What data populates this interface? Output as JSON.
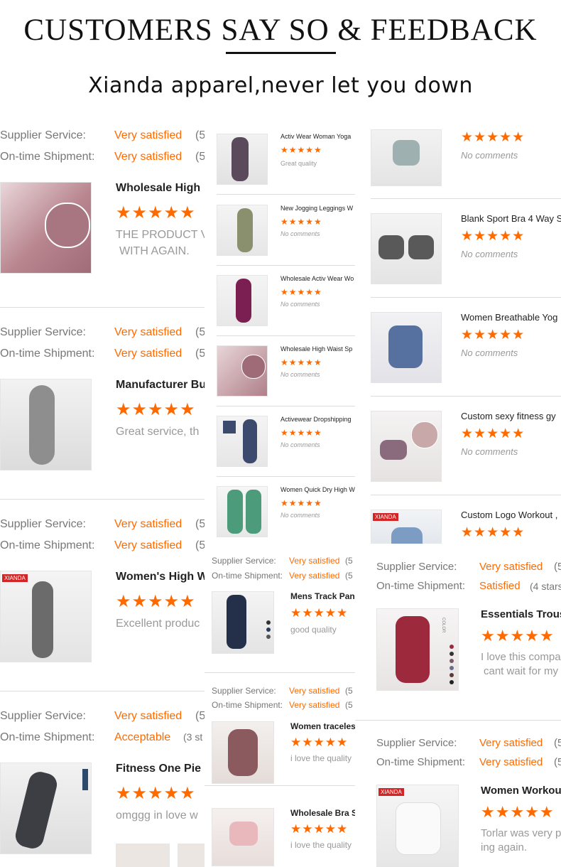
{
  "header": {
    "title": "CUSTOMERS SAY SO & FEEDBACK",
    "subtitle": "Xianda apparel,never let you down"
  },
  "labels": {
    "supplier_service": "Supplier Service:",
    "ontime_shipment": "On-time Shipment:",
    "very_satisfied": "Very satisfied",
    "no_comments": "No comments",
    "cut_5": "(5"
  },
  "stars": "★★★★★",
  "left_reviews": [
    {
      "supplier": "Very satisfied",
      "shipment": "Very satisfied",
      "product": "Wholesale High",
      "comment_1": "THE PRODUCT V",
      "comment_2": "WITH AGAIN."
    },
    {
      "supplier": "Very satisfied",
      "shipment": "Very satisfied",
      "product": "Manufacturer Bu",
      "comment_1": "Great service, th"
    },
    {
      "supplier": "Very satisfied",
      "shipment": "Very satisfied",
      "product": "Women's High W",
      "comment_1": "Excellent produc"
    },
    {
      "supplier": "Very satisfied",
      "shipment": "Acceptable",
      "shipment_extra": "(3 st",
      "product": "Fitness One Pie",
      "comment_1": "omggg in love w"
    }
  ],
  "middle_list": [
    {
      "title": "Activ Wear Woman Yoga",
      "comment": "Great quality"
    },
    {
      "title": "New Jogging Leggings W",
      "comment": "No comments"
    },
    {
      "title": "Wholesale Activ Wear Wo",
      "comment": "No comments"
    },
    {
      "title": "Wholesale High Waist Sp",
      "comment": "No comments"
    },
    {
      "title": "Activewear Dropshipping",
      "comment": "No comments"
    },
    {
      "title": "Women Quick Dry High W",
      "comment": "No comments"
    }
  ],
  "middle_reviews": [
    {
      "supplier": "Very satisfied",
      "shipment": "Very satisfied",
      "product": "Mens Track Pan",
      "comment": "good quality"
    },
    {
      "supplier": "Very satisfied",
      "shipment": "Very satisfied",
      "product": "Women traceles",
      "comment": "i love the quality"
    },
    {
      "product": "Wholesale Bra S",
      "comment": "i love the quality"
    }
  ],
  "right_list": [
    {
      "title": "",
      "comment": "No comments"
    },
    {
      "title": "Blank Sport Bra 4 Way S",
      "comment": "No comments"
    },
    {
      "title": "Women Breathable Yog",
      "comment": "No comments"
    },
    {
      "title": "Custom sexy fitness gy",
      "comment": "No comments"
    },
    {
      "title": "Custom Logo Workout ,",
      "comment": ""
    }
  ],
  "right_reviews": [
    {
      "supplier": "Very satisfied",
      "shipment": "Satisfied",
      "shipment_extra": "(4 stars",
      "product": "Essentials Trous",
      "comment_1": "I love this compa",
      "comment_2": "cant wait for my"
    },
    {
      "supplier": "Very satisfied",
      "shipment": "Very satisfied",
      "product": "Women Workout",
      "comment_1": "Torlar was very p",
      "comment_2": "ing again."
    }
  ],
  "badges": {
    "brand": "XIANDA",
    "color": "COLOR"
  },
  "colors": {
    "accent": "#ff6a00",
    "text": "#333333",
    "muted": "#777777"
  }
}
